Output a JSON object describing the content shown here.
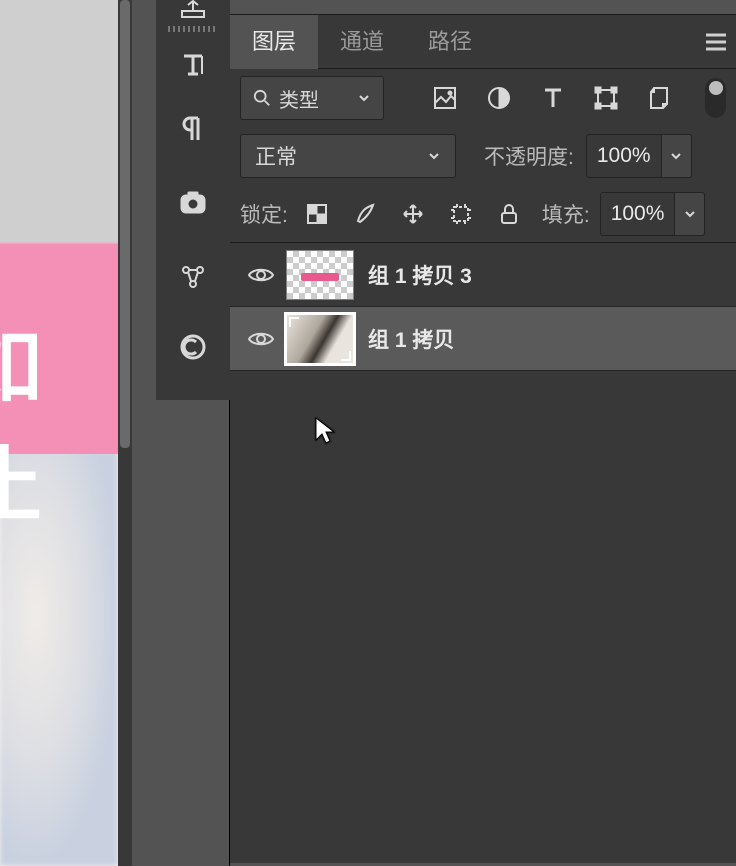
{
  "canvas": {
    "overlay_text": "如止"
  },
  "tool_column": {
    "icons": [
      "export-icon",
      "text-tool-icon",
      "paragraph-icon",
      "camera-icon",
      "share-icon",
      "cc-icon"
    ]
  },
  "panel": {
    "tabs": {
      "layers": "图层",
      "channels": "通道",
      "paths": "路径"
    },
    "filter": {
      "type_label": "类型"
    },
    "blend": {
      "mode": "正常",
      "opacity_label": "不透明度:",
      "opacity_value": "100%"
    },
    "lock": {
      "label": "锁定:",
      "fill_label": "填充:",
      "fill_value": "100%"
    },
    "layers": [
      {
        "name": "组 1 拷贝 3",
        "visible": true,
        "selected": false,
        "thumb": "checker"
      },
      {
        "name": "组 1 拷贝",
        "visible": true,
        "selected": true,
        "thumb": "photo"
      }
    ]
  }
}
